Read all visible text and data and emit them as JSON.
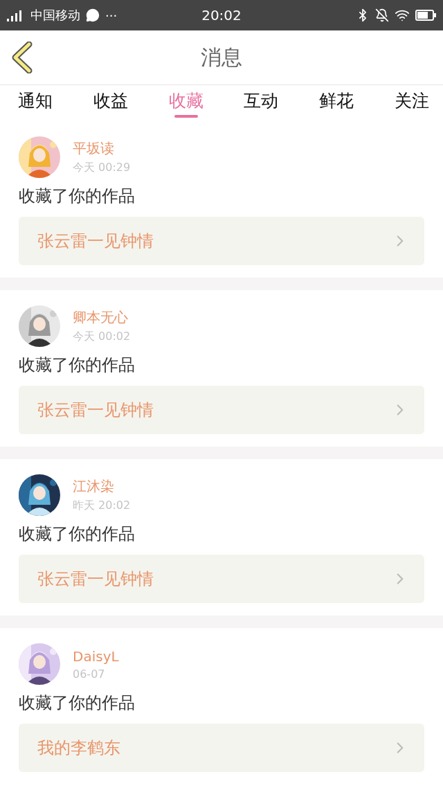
{
  "status_bar": {
    "carrier": "中国移动",
    "more": "···",
    "time": "20:02"
  },
  "header": {
    "title": "消息"
  },
  "tabs": [
    {
      "label": "通知",
      "selected": false
    },
    {
      "label": "收益",
      "selected": false
    },
    {
      "label": "收藏",
      "selected": true
    },
    {
      "label": "互动",
      "selected": false
    },
    {
      "label": "鲜花",
      "selected": false
    },
    {
      "label": "关注",
      "selected": false
    }
  ],
  "messages": [
    {
      "user": "平坂读",
      "time": "今天 00:29",
      "text": "收藏了你的作品",
      "work": "张云雷一见钟情"
    },
    {
      "user": "卿本无心",
      "time": "今天 00:02",
      "text": "收藏了你的作品",
      "work": "张云雷一见钟情"
    },
    {
      "user": "江沐染",
      "time": "昨天 20:02",
      "text": "收藏了你的作品",
      "work": "张云雷一见钟情"
    },
    {
      "user": "DaisyL",
      "time": "06-07",
      "text": "收藏了你的作品",
      "work": "我的李鹤东"
    }
  ]
}
